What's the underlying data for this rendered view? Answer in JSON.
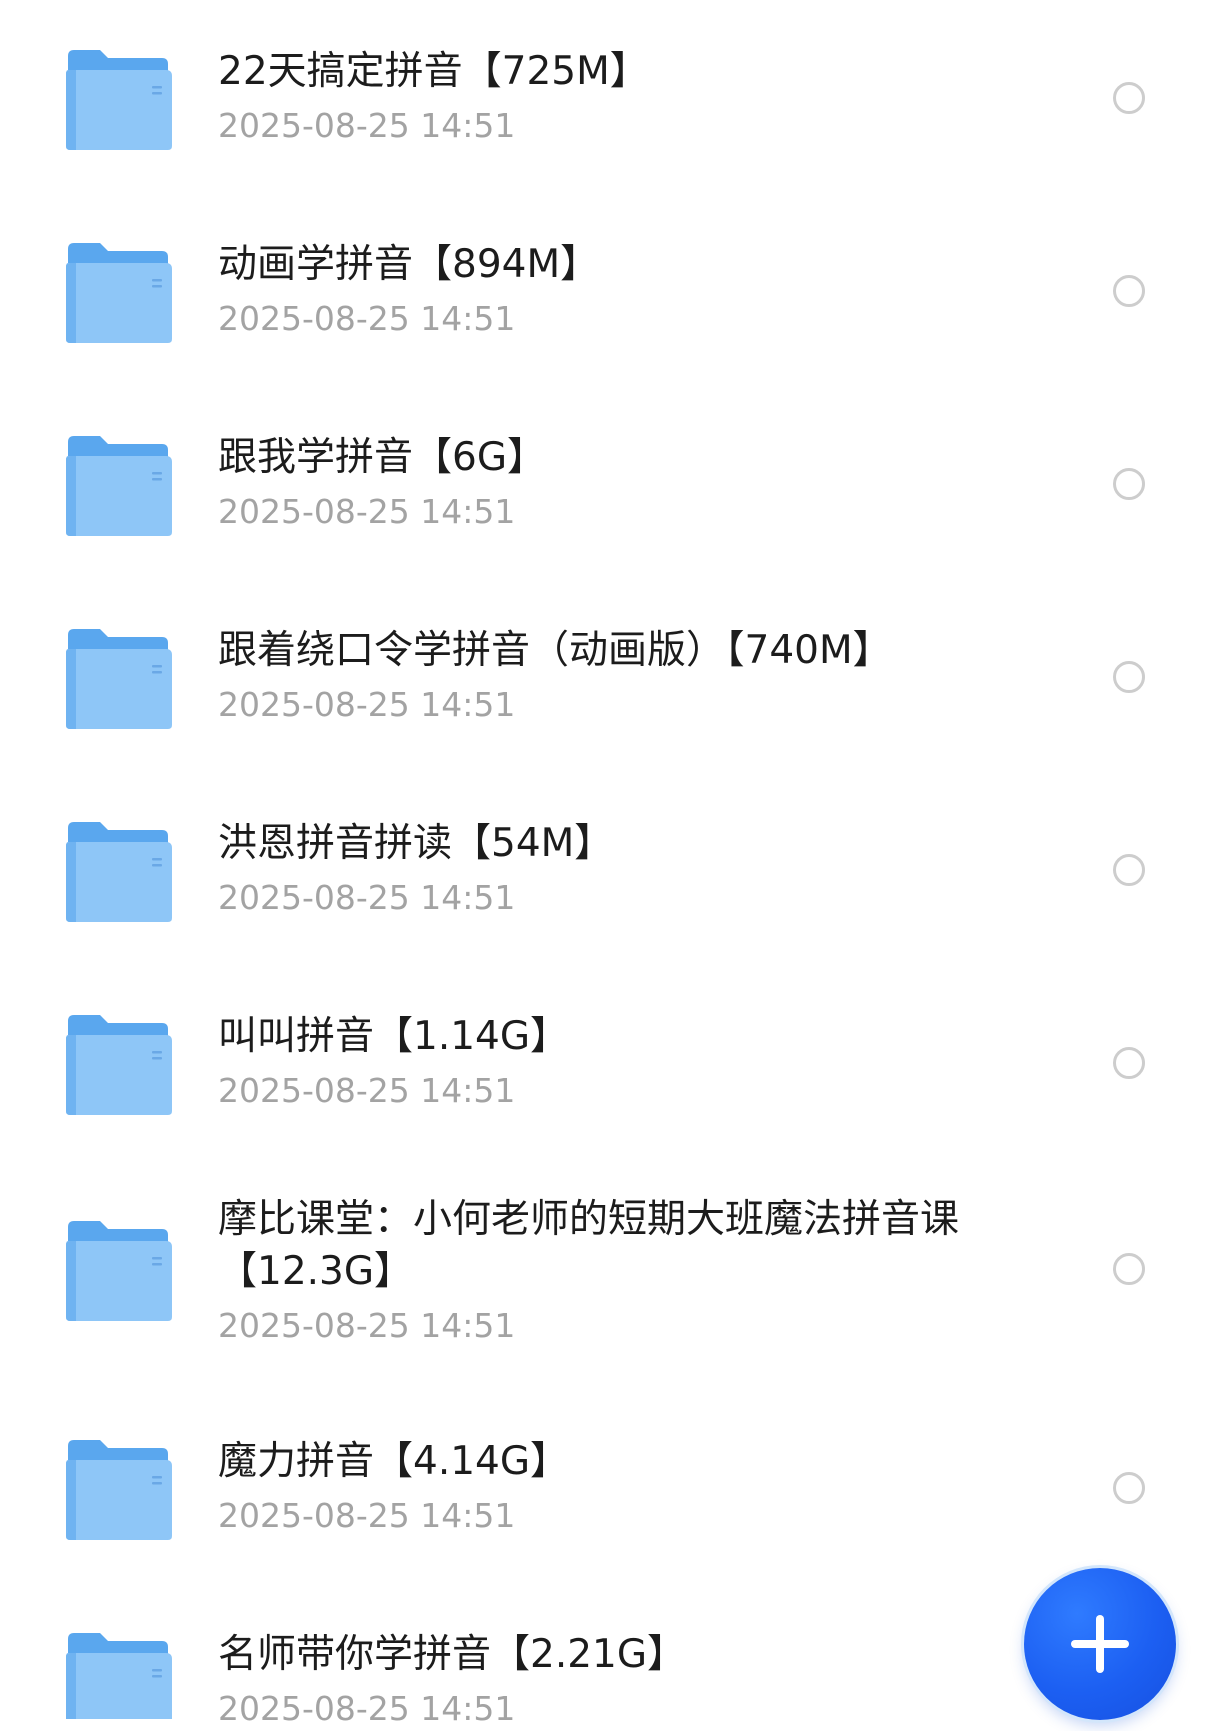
{
  "icons": {
    "folder": "folder-icon",
    "select": "radio-circle-icon",
    "add": "plus-icon"
  },
  "colors": {
    "folder_back": "#5aa7ee",
    "folder_front": "#8ec6f7",
    "title_text": "#1c1c1c",
    "date_text": "#a3a3a3",
    "radio_border": "#cdcdcd",
    "fab_blue": "#1c5ff2"
  },
  "files": [
    {
      "name": "22天搞定拼音【725M】",
      "date": "2025-08-25 14:51"
    },
    {
      "name": "动画学拼音【894M】",
      "date": "2025-08-25 14:51"
    },
    {
      "name": "跟我学拼音【6G】",
      "date": "2025-08-25 14:51"
    },
    {
      "name": "跟着绕口令学拼音（动画版）【740M】",
      "date": "2025-08-25 14:51"
    },
    {
      "name": "洪恩拼音拼读【54M】",
      "date": "2025-08-25 14:51"
    },
    {
      "name": "叫叫拼音【1.14G】",
      "date": "2025-08-25 14:51"
    },
    {
      "name": "摩比课堂：小何老师的短期大班魔法拼音课【12.3G】",
      "date": "2025-08-25 14:51"
    },
    {
      "name": "魔力拼音【4.14G】",
      "date": "2025-08-25 14:51"
    },
    {
      "name": "名师带你学拼音【2.21G】",
      "date": "2025-08-25 14:51"
    }
  ]
}
